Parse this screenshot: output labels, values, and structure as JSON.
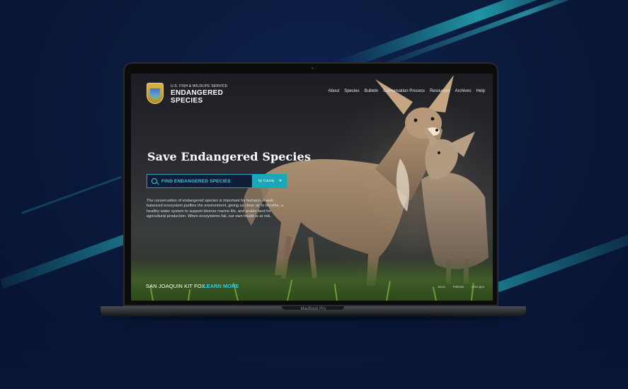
{
  "brand": {
    "agency": "U.S. FISH & WILDLIFE SERVICE",
    "title_line1": "ENDANGERED",
    "title_line2": "SPECIES"
  },
  "nav": {
    "items": [
      {
        "label": "About"
      },
      {
        "label": "Species"
      },
      {
        "label": "Bulletin"
      },
      {
        "label": "Conservation Process"
      },
      {
        "label": "Resources"
      },
      {
        "label": "Archives"
      },
      {
        "label": "Help"
      }
    ]
  },
  "hero": {
    "title": "Save Endangered Species",
    "search_label": "FIND ENDANGERED SPECIES",
    "filter_label": "by County",
    "paragraph": "The conservation of endangered species is important for humans. A well-balanced ecosystem purifies the environment, giving us clean air to breathe, a healthy water system to support diverse marine life, and arable land for agricultural production. When ecosystems fail, our own health is at risk.",
    "caption": "SAN JOAQUIN KIT FOX",
    "cta": "LEARN MORE"
  },
  "footer": {
    "links": [
      {
        "label": "Ecos"
      },
      {
        "label": "Policies"
      },
      {
        "label": "USA.gov"
      }
    ]
  },
  "device": {
    "label": "MacBook Pro"
  },
  "colors": {
    "accent": "#3ec9d6",
    "button": "#1aa8b9",
    "background": "#0a1a3c"
  },
  "icons": [
    "search-icon",
    "caret-down-icon",
    "agency-badge-icon"
  ]
}
